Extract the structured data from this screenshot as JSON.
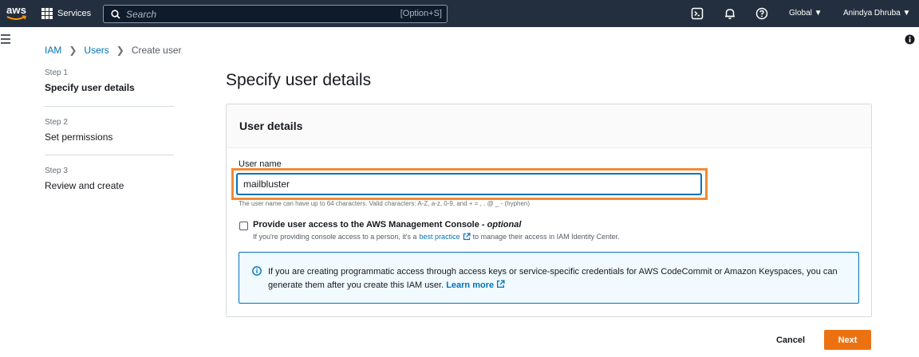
{
  "topbar": {
    "logo_text": "aws",
    "services_label": "Services",
    "search_placeholder": "Search",
    "search_shortcut": "[Option+S]",
    "region_label": "Global ▼",
    "user_label": "Anindya Dhruba ▼",
    "icons": [
      "grid-icon",
      "search-icon",
      "cloudshell-icon",
      "bell-icon",
      "help-icon"
    ]
  },
  "breadcrumb": {
    "items": [
      "IAM",
      "Users",
      "Create user"
    ]
  },
  "steps": [
    {
      "label": "Step 1",
      "title": "Specify user details"
    },
    {
      "label": "Step 2",
      "title": "Set permissions"
    },
    {
      "label": "Step 3",
      "title": "Review and create"
    }
  ],
  "page_title": "Specify user details",
  "panel": {
    "header": "User details",
    "username_label": "User name",
    "username_value": "mailbluster",
    "username_hint": "The user name can have up to 64 characters. Valid characters: A-Z, a-z, 0-9, and + = , . @ _ - (hyphen)",
    "console_access_label": "Provide user access to the AWS Management Console - ",
    "console_access_optional": "optional",
    "console_desc_pre": "If you're providing console access to a person, it's a",
    "console_desc_link": "best practice",
    "console_desc_post": "to manage their access in IAM Identity Center.",
    "alert_text": "If you are creating programmatic access through access keys or service-specific credentials for AWS CodeCommit or Amazon Keyspaces, you can generate them after you create this IAM user.",
    "alert_link": "Learn more"
  },
  "actions": {
    "cancel_label": "Cancel",
    "next_label": "Next"
  },
  "colors": {
    "nav_bg": "#232f3e",
    "link": "#0073bb",
    "primary": "#ec7211",
    "highlight": "#f08b38"
  }
}
